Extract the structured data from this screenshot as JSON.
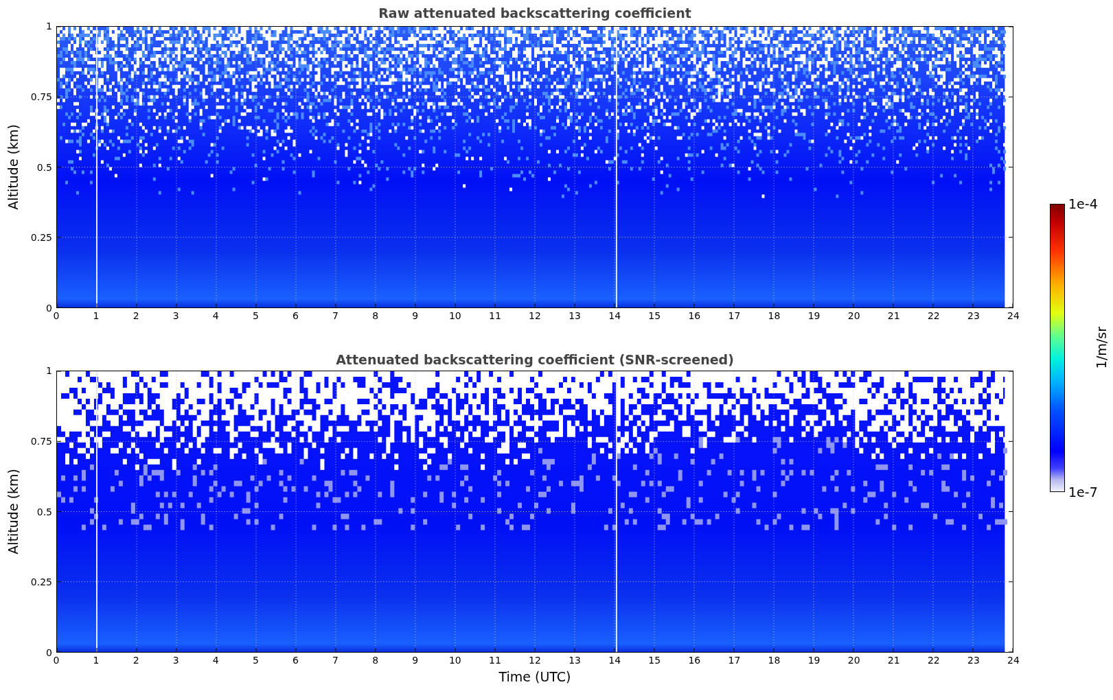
{
  "panels": [
    {
      "kind": "raw",
      "title": "Raw attenuated backscattering coefficient",
      "ylabel": "Altitude (km)",
      "yticks": [
        "1",
        "0.75",
        "0.5",
        "0.25",
        "0"
      ],
      "xticks": [
        "0",
        "1",
        "2",
        "3",
        "4",
        "5",
        "6",
        "7",
        "8",
        "9",
        "10",
        "11",
        "12",
        "13",
        "14",
        "15",
        "16",
        "17",
        "18",
        "19",
        "20",
        "21",
        "22",
        "23",
        "24"
      ]
    },
    {
      "kind": "screened",
      "title": "Attenuated backscattering coefficient (SNR-screened)",
      "ylabel": "Altitude (km)",
      "yticks": [
        "1",
        "0.75",
        "0.5",
        "0.25",
        "0"
      ],
      "xticks": [
        "0",
        "1",
        "2",
        "3",
        "4",
        "5",
        "6",
        "7",
        "8",
        "9",
        "10",
        "11",
        "12",
        "13",
        "14",
        "15",
        "16",
        "17",
        "18",
        "19",
        "20",
        "21",
        "22",
        "23",
        "24"
      ]
    }
  ],
  "xlabel": "Time (UTC)",
  "colorbar": {
    "max_label": "1e-4",
    "min_label": "1e-7",
    "label": "1/m/sr"
  }
}
